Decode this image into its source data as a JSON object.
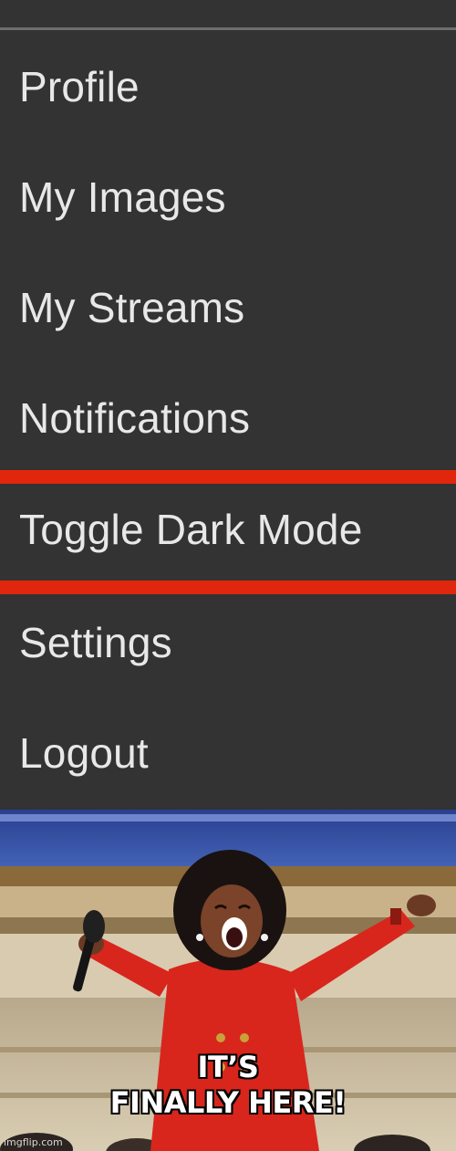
{
  "menu": {
    "items": [
      {
        "label": "Profile"
      },
      {
        "label": "My Images"
      },
      {
        "label": "My Streams"
      },
      {
        "label": "Notifications"
      },
      {
        "label": "Toggle Dark Mode",
        "highlighted": true
      },
      {
        "label": "Settings"
      },
      {
        "label": "Logout"
      }
    ],
    "highlight_color": "#e0260c",
    "background_color": "#333333",
    "text_color": "#e8e8e8"
  },
  "meme": {
    "caption_line1": "IT’S",
    "caption_line2": "FINALLY HERE!",
    "watermark": "imgflip.com"
  }
}
